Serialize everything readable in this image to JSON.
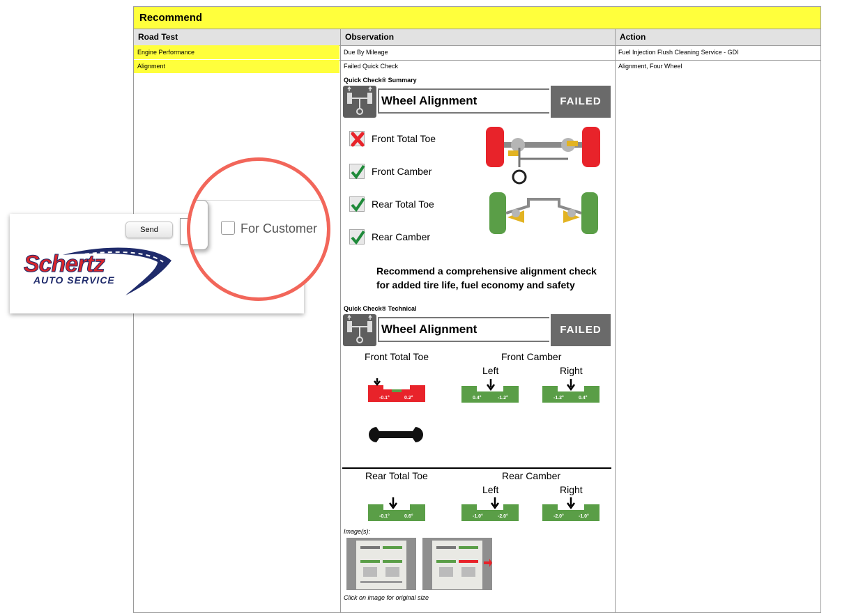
{
  "table": {
    "title": "Recommend",
    "columns": [
      "Road Test",
      "Observation",
      "Action"
    ],
    "rows": [
      {
        "road_test": "Engine Performance",
        "observation": "Due By Mileage",
        "action": "Fuel Injection Flush Cleaning Service - GDI"
      },
      {
        "road_test": "Alignment",
        "observation": "Failed Quick Check",
        "action": "Alignment, Four Wheel"
      }
    ]
  },
  "summary": {
    "label": "Quick Check® Summary",
    "title": "Wheel Alignment",
    "status": "FAILED",
    "checks": [
      {
        "label": "Front Total Toe",
        "pass": false
      },
      {
        "label": "Front Camber",
        "pass": true
      },
      {
        "label": "Rear Total Toe",
        "pass": true
      },
      {
        "label": "Rear Camber",
        "pass": true
      }
    ],
    "recommendation_line1": "Recommend a comprehensive alignment check",
    "recommendation_line2": "for added tire life, fuel economy and safety"
  },
  "technical": {
    "label": "Quick Check® Technical",
    "title": "Wheel Alignment",
    "status": "FAILED",
    "front_total_toe": {
      "label": "Front Total Toe",
      "min": "-0.1°",
      "max": "0.2°"
    },
    "front_camber": {
      "label": "Front Camber",
      "left_label": "Left",
      "right_label": "Right",
      "left_min": "0.4°",
      "left_max": "-1.2°",
      "right_min": "-1.2°",
      "right_max": "0.4°"
    },
    "rear_total_toe": {
      "label": "Rear Total Toe",
      "min": "-0.1°",
      "max": "0.6°"
    },
    "rear_camber": {
      "label": "Rear Camber",
      "left_label": "Left",
      "right_label": "Right",
      "left_min": "-1.0°",
      "left_max": "-2.0°",
      "right_min": "-2.0°",
      "right_max": "-1.0°"
    }
  },
  "images": {
    "label": "Image(s):",
    "caption": "Click on image for original size"
  },
  "overlay": {
    "send_label": "Send",
    "customer_label": "For Customer",
    "logo_main": "Schertz",
    "logo_sub": "AUTO SERVICE"
  },
  "colors": {
    "highlight": "#ffff3c",
    "header_bg": "#e2e2e2",
    "fail_red": "#e8232a",
    "pass_green": "#5a9e47",
    "zoom_ring": "#f2665a",
    "logo_red": "#d9252b",
    "logo_navy": "#1f2b6b"
  }
}
